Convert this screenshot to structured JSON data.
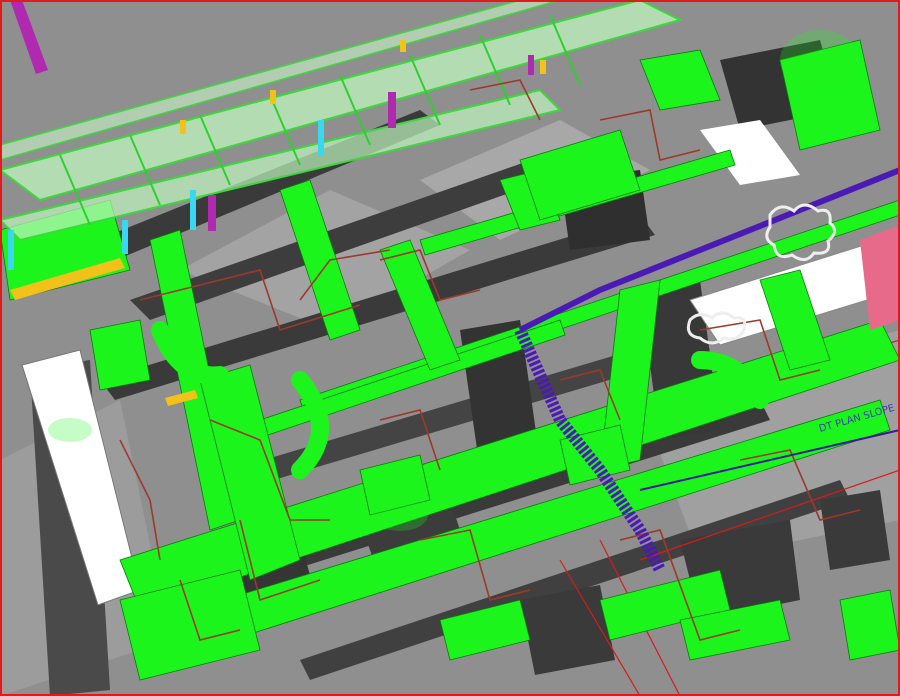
{
  "viewport": {
    "title": "",
    "frame_color": "#e11b1b"
  },
  "colors": {
    "background": "#8f8f8f",
    "floor": "#9a9a9a",
    "wall_dark": "#3a3a3a",
    "wall_mid": "#5a5a5a",
    "duct": "#1cf51c",
    "duct_light": "#9ef79e",
    "tray": "#bff5bf",
    "pipe_red": "#9c3a2a",
    "pipe_purple": "#4a1ab5",
    "white_duct": "#ffffff",
    "magenta": "#b02ab0",
    "cyan": "#3ad8f0",
    "yellow": "#f2c21a",
    "pink": "#e86a8a",
    "red_line": "#d81b1b"
  },
  "annotations": [
    {
      "text": "DT PLAN SLOPE"
    }
  ],
  "icons": {
    "magenta_column": "vertical-column-icon",
    "pink_block": "equipment-block-icon",
    "cloud_markup": "revision-cloud-icon"
  }
}
